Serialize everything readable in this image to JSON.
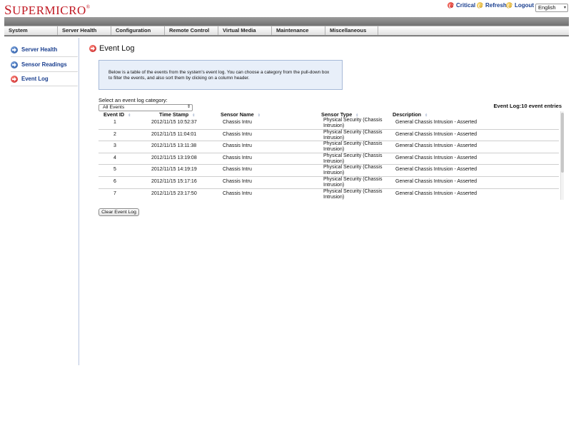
{
  "brand": {
    "logo_text": "SUPERMICRO",
    "logo_first": "S",
    "logo_rest": "UPERMICRO",
    "registered": "®"
  },
  "header_links": {
    "critical": "Critical",
    "refresh": "Refresh",
    "logout": "Logout"
  },
  "language": {
    "selected": "English"
  },
  "nav": {
    "items": [
      "System",
      "Server Health",
      "Configuration",
      "Remote Control",
      "Virtual Media",
      "Maintenance",
      "Miscellaneous"
    ]
  },
  "sidebar": {
    "items": [
      {
        "label": "Server Health",
        "active": false
      },
      {
        "label": "Sensor Readings",
        "active": false
      },
      {
        "label": "Event Log",
        "active": true
      }
    ]
  },
  "main": {
    "title": "Event Log",
    "info_text": "Below is a table of the events from the system's event log. You can choose a category from the pull-down box to filter the events, and also sort them by clicking on a column header.",
    "category_label": "Select an event log category:",
    "category_selected": "All Events",
    "count_label": "Event Log:10 event entries",
    "clear_button": "Clear Event Log"
  },
  "table": {
    "columns": [
      "Event ID",
      "Time Stamp",
      "Sensor Name",
      "Sensor Type",
      "Description"
    ],
    "rows": [
      {
        "id": "1",
        "time": "2012/11/15 10:52:37",
        "sensor": "Chassis Intru",
        "type": "Physical Security (Chassis Intrusion)",
        "desc": "General Chassis Intrusion - Asserted"
      },
      {
        "id": "2",
        "time": "2012/11/15 11:04:01",
        "sensor": "Chassis Intru",
        "type": "Physical Security (Chassis Intrusion)",
        "desc": "General Chassis Intrusion - Asserted"
      },
      {
        "id": "3",
        "time": "2012/11/15 13:11:38",
        "sensor": "Chassis Intru",
        "type": "Physical Security (Chassis Intrusion)",
        "desc": "General Chassis Intrusion - Asserted"
      },
      {
        "id": "4",
        "time": "2012/11/15 13:19:08",
        "sensor": "Chassis Intru",
        "type": "Physical Security (Chassis Intrusion)",
        "desc": "General Chassis Intrusion - Asserted"
      },
      {
        "id": "5",
        "time": "2012/11/15 14:19:19",
        "sensor": "Chassis Intru",
        "type": "Physical Security (Chassis Intrusion)",
        "desc": "General Chassis Intrusion - Asserted"
      },
      {
        "id": "6",
        "time": "2012/11/15 15:17:16",
        "sensor": "Chassis Intru",
        "type": "Physical Security (Chassis Intrusion)",
        "desc": "General Chassis Intrusion - Asserted"
      },
      {
        "id": "7",
        "time": "2012/11/15 23:17:50",
        "sensor": "Chassis Intru",
        "type": "Physical Security (Chassis Intrusion)",
        "desc": "General Chassis Intrusion - Asserted"
      }
    ]
  },
  "colors": {
    "brand_red": "#c01822",
    "link_blue": "#1a3f8f",
    "info_bg": "#e8eff9"
  }
}
